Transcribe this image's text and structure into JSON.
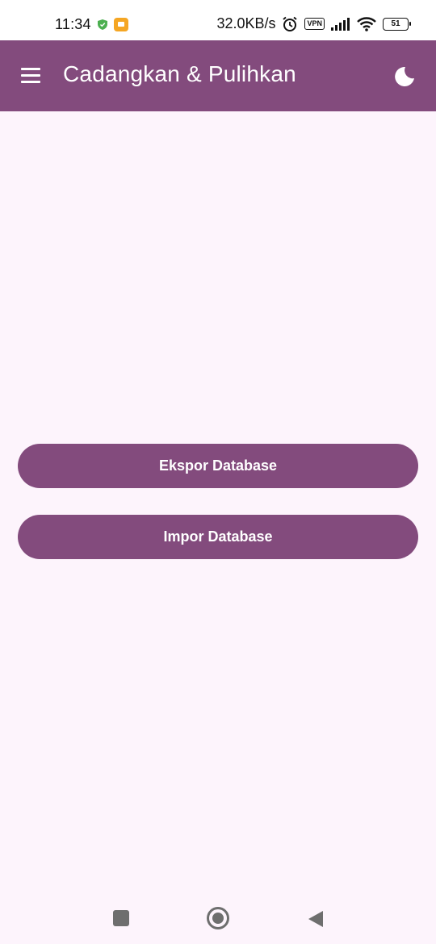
{
  "status_bar": {
    "time": "11:34",
    "speed": "32.0KB/s",
    "vpn": "VPN",
    "battery": "51"
  },
  "app_bar": {
    "title": "Cadangkan & Pulihkan",
    "menu_icon": "hamburger-menu-icon",
    "theme_icon": "moon-icon"
  },
  "actions": {
    "export_label": "Ekspor Database",
    "import_label": "Impor Database"
  },
  "colors": {
    "primary": "#834B7D",
    "background": "#FDF4FC",
    "on_primary": "#FFFFFF"
  },
  "nav_bar": {
    "recent_icon": "recent-apps-icon",
    "home_icon": "home-icon",
    "back_icon": "back-icon"
  }
}
